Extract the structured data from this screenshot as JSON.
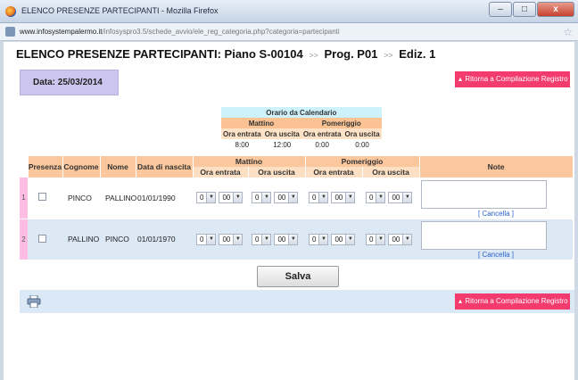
{
  "window": {
    "title": "ELENCO PRESENZE PARTECIPANTI - Mozilla Firefox",
    "minimize": "–",
    "maximize": "□",
    "close": "x"
  },
  "address": {
    "host": "www.infosystempalermo.it",
    "path": "/infosyspro3.5/schede_avvio/ele_reg_categoria.php?categoria=partecipanti"
  },
  "page": {
    "title_main": "ELENCO PRESENZE PARTECIPANTI: Piano S-00104",
    "sep": ">>",
    "title_prog": "Prog. P01",
    "title_ediz": "Ediz. 1",
    "date_label": "Data: 25/03/2014",
    "return_label": "Ritorna a Compilazione Registro",
    "save_label": "Salva"
  },
  "calendar": {
    "title": "Orario da Calendario",
    "mattino": "Mattino",
    "pomeriggio": "Pomeriggio",
    "ora_entrata": "Ora entrata",
    "ora_uscita": "Ora uscita",
    "values": [
      "8:00",
      "12:00",
      "0:00",
      "0:00"
    ]
  },
  "grid": {
    "headers": {
      "presenza": "Presenza",
      "cognome": "Cognome",
      "nome": "Nome",
      "nascita": "Data di nascita",
      "mattino": "Mattino",
      "pomeriggio": "Pomeriggio",
      "ora_entrata": "Ora entrata",
      "ora_uscita": "Ora uscita",
      "note": "Note"
    },
    "rows": [
      {
        "num": "1",
        "cognome": "PINCO",
        "nome": "PALLINO",
        "nascita": "01/01/1990",
        "hour": "0",
        "min": "00",
        "cancel": "[ Cancella ]"
      },
      {
        "num": "2",
        "cognome": "PALLINO",
        "nome": "PINCO",
        "nascita": "01/01/1970",
        "hour": "0",
        "min": "00",
        "cancel": "[ Cancella ]"
      }
    ]
  },
  "colors": {
    "header_orange": "#fbc79c",
    "return_button": "#f43b6d",
    "date_box": "#ccc6ee",
    "row_alt": "#dde8f5",
    "row_number": "#ffbde3"
  },
  "icons": {
    "print": "printer-icon",
    "bookmark": "star-icon",
    "arrow": "up-arrow-icon"
  }
}
